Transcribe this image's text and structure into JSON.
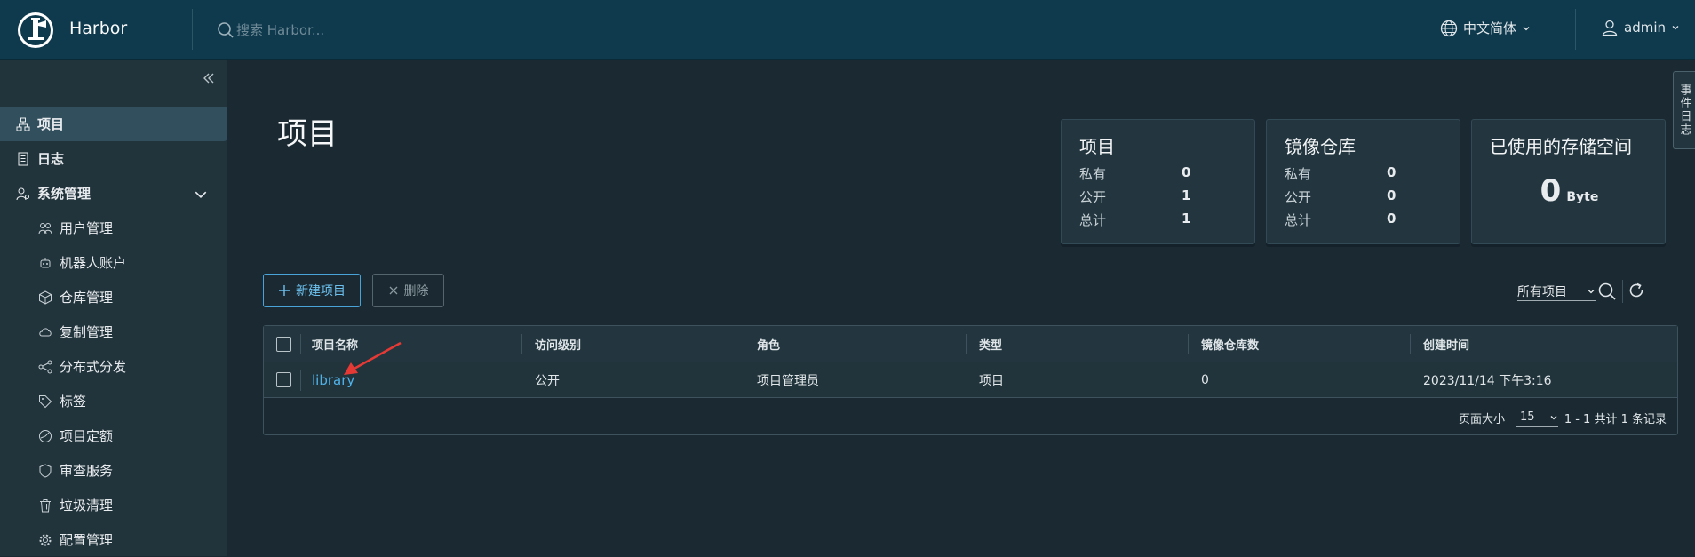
{
  "header": {
    "brand": "Harbor",
    "search_placeholder": "搜索 Harbor...",
    "language": "中文简体",
    "user": "admin"
  },
  "sidebar": {
    "items": [
      {
        "label": "项目",
        "icon": "projects-icon",
        "active": true
      },
      {
        "label": "日志",
        "icon": "logs-icon"
      },
      {
        "label": "系统管理",
        "icon": "admin-icon",
        "expanded": true
      },
      {
        "label": "用户管理",
        "icon": "users-icon"
      },
      {
        "label": "机器人账户",
        "icon": "robot-icon"
      },
      {
        "label": "仓库管理",
        "icon": "registry-icon"
      },
      {
        "label": "复制管理",
        "icon": "replication-icon"
      },
      {
        "label": "分布式分发",
        "icon": "distribution-icon"
      },
      {
        "label": "标签",
        "icon": "tag-icon"
      },
      {
        "label": "项目定额",
        "icon": "quota-icon"
      },
      {
        "label": "审查服务",
        "icon": "shield-icon"
      },
      {
        "label": "垃圾清理",
        "icon": "trash-icon"
      },
      {
        "label": "配置管理",
        "icon": "gear-icon"
      }
    ]
  },
  "main": {
    "title": "项目",
    "cards": {
      "projects": {
        "title": "项目",
        "rows": [
          {
            "label": "私有",
            "value": "0"
          },
          {
            "label": "公开",
            "value": "1"
          },
          {
            "label": "总计",
            "value": "1"
          }
        ]
      },
      "repos": {
        "title": "镜像仓库",
        "rows": [
          {
            "label": "私有",
            "value": "0"
          },
          {
            "label": "公开",
            "value": "0"
          },
          {
            "label": "总计",
            "value": "0"
          }
        ]
      },
      "storage": {
        "title": "已使用的存储空间",
        "value": "0",
        "unit": "Byte"
      }
    },
    "buttons": {
      "new_project": "新建项目",
      "delete": "删除"
    },
    "filter": {
      "selected": "所有项目"
    },
    "table": {
      "columns": [
        "项目名称",
        "访问级别",
        "角色",
        "类型",
        "镜像仓库数",
        "创建时间"
      ],
      "rows": [
        {
          "name": "library",
          "access": "公开",
          "role": "项目管理员",
          "type": "项目",
          "repo_count": "0",
          "created": "2023/11/14 下午3:16"
        }
      ],
      "footer": {
        "page_size_label": "页面大小",
        "page_size": "15",
        "total": "1 - 1 共计 1 条记录"
      }
    }
  },
  "side_tab": "事件日志",
  "colors": {
    "accent": "#4fb3ea",
    "header_bg": "#0f3a4e",
    "arrow": "#e53935"
  }
}
